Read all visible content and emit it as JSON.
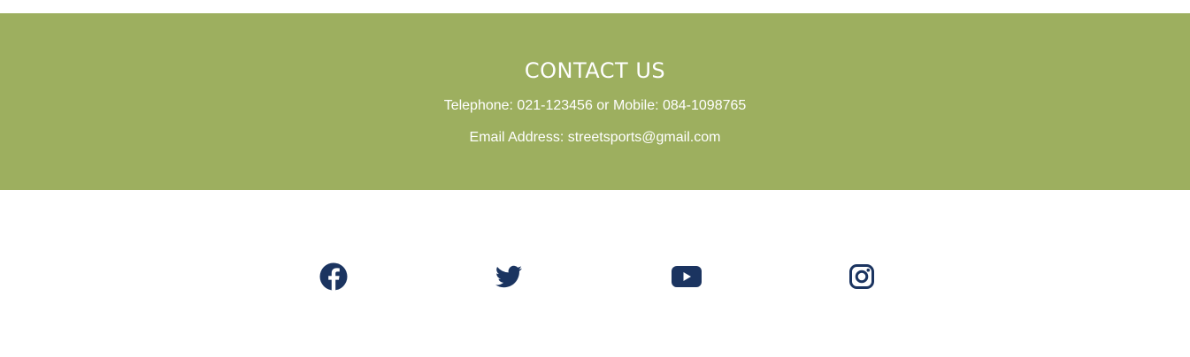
{
  "contact": {
    "title": "CONTACT US",
    "phone_line": "Telephone: 021-123456 or Mobile: 084-1098765",
    "email_line": "Email Address: streetsports@gmail.com",
    "background_color": "#9daf5f",
    "text_color": "#ffffff"
  },
  "social": {
    "icon_color": "#1b3460",
    "links": [
      {
        "name": "facebook",
        "icon": "facebook-icon"
      },
      {
        "name": "twitter",
        "icon": "twitter-icon"
      },
      {
        "name": "youtube",
        "icon": "youtube-icon"
      },
      {
        "name": "instagram",
        "icon": "instagram-icon"
      }
    ]
  }
}
